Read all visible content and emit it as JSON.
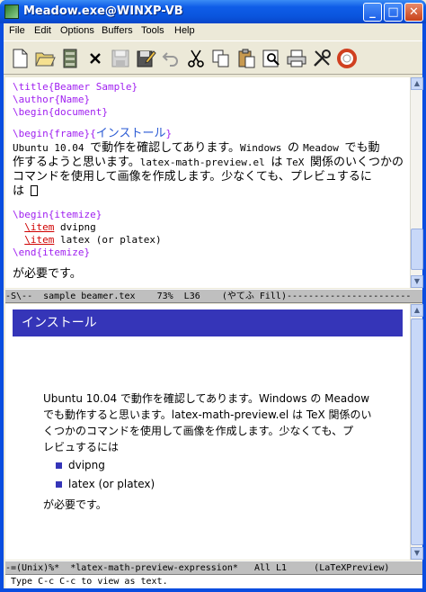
{
  "window": {
    "title": "Meadow.exe@WINXP-VB",
    "minimize": "_",
    "maximize": "□",
    "close": "✕"
  },
  "menu": [
    "File",
    "Edit",
    "Options",
    "Buffers",
    "Tools",
    "Help"
  ],
  "toolbar_icons": [
    "new-file-icon",
    "open-folder-icon",
    "dired-icon",
    "close-buffer-icon",
    "save-icon",
    "save-as-icon",
    "undo-icon",
    "cut-icon",
    "copy-icon",
    "paste-icon",
    "search-icon",
    "print-icon",
    "preferences-icon",
    "help-icon"
  ],
  "editor": {
    "l1": "\\title{Beamer Sample}",
    "l2": "\\author{Name}",
    "l3": "\\begin{document}",
    "l4a": "\\begin{frame}{",
    "l4b": "インストール",
    "l4c": "}",
    "l5a": "Ubuntu 10.04 ",
    "l5b": "で動作を確認してあります。",
    "l5c": "Windows ",
    "l5d": "の ",
    "l5e": "Meadow ",
    "l5f": "でも動",
    "l6a": "作するようと思います。",
    "l6b": "latex-math-preview.el ",
    "l6c": "は ",
    "l6d": "TeX ",
    "l6e": "関係のいくつかの",
    "l7": "コマンドを使用して画像を作成します。少なくても、プレビュするに",
    "l8": "は",
    "l9": "\\begin{itemize}",
    "l10a": "\\item",
    "l10b": " dvipng",
    "l11a": "\\item",
    "l11b": " latex (or platex)",
    "l12": "\\end{itemize}",
    "l13": "が必要です。"
  },
  "modeline1": "-S\\--  sample beamer.tex    73%  L36    (やてふ Fill)-----------------------",
  "preview": {
    "heading": "インストール",
    "p1": "Ubuntu 10.04 で動作を確認してあります。Windows の Meadow",
    "p2": "でも動作すると思います。latex-math-preview.el は TeX 関係のい",
    "p3": "くつかのコマンドを使用して画像を作成します。少なくても、プ",
    "p4": "レビュするには",
    "item1": "dvipng",
    "item2": "latex (or platex)",
    "after": "が必要です。"
  },
  "modeline2": "-=(Unix)%*  *latex-math-preview-expression*   All L1     (LaTeXPreview)",
  "minibuffer": "Type C-c C-c to view as text."
}
